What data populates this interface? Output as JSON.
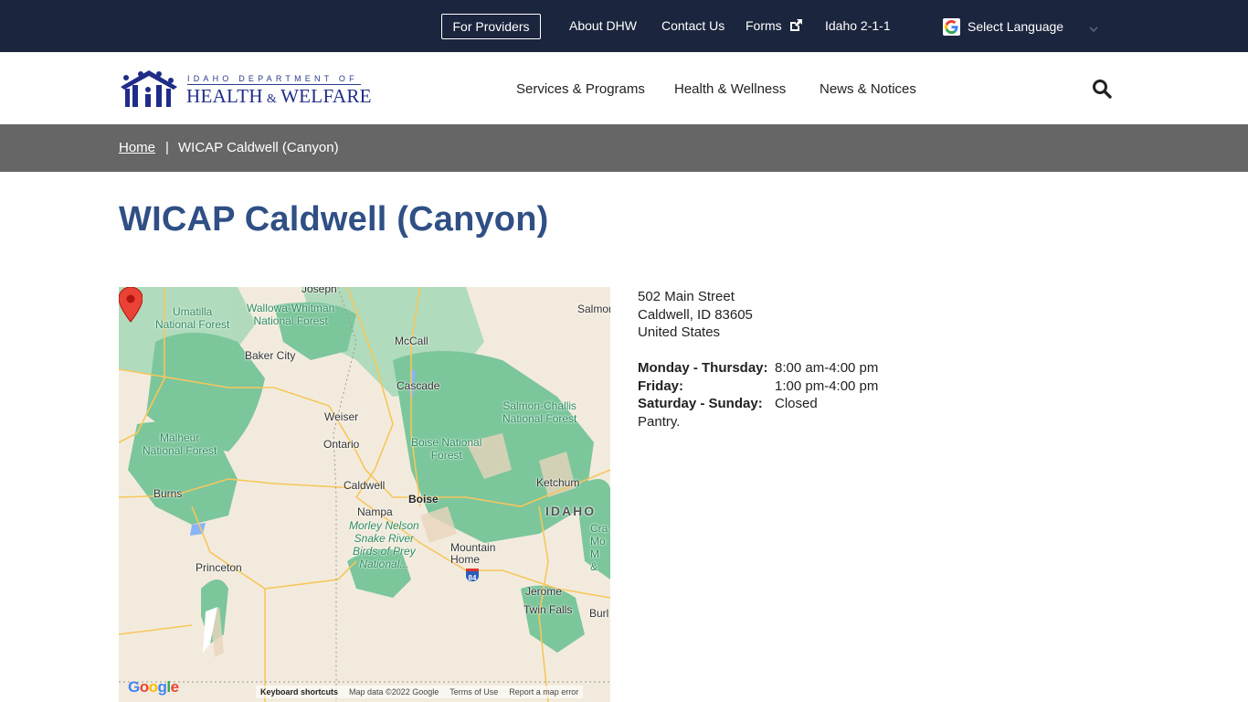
{
  "topbar": {
    "for_providers": "For Providers",
    "links": [
      "About DHW",
      "Contact Us",
      "Forms",
      "Idaho 2-1-1"
    ],
    "forms_icon": "external-link-icon",
    "language": "Select Language"
  },
  "header": {
    "logo_line1": "IDAHO DEPARTMENT OF",
    "logo_line2a": "HEALTH",
    "logo_amp": "&",
    "logo_line2b": "WELFARE",
    "nav": [
      "Services & Programs",
      "Health & Wellness",
      "News & Notices"
    ],
    "search_icon": "search-icon"
  },
  "breadcrumb": {
    "home": "Home",
    "separator": "|",
    "current": "WICAP Caldwell (Canyon)"
  },
  "page": {
    "title": "WICAP Caldwell (Canyon)"
  },
  "location": {
    "address": [
      "502 Main Street",
      "Caldwell, ID 83605",
      "United States"
    ],
    "hours": [
      {
        "day": "Monday - Thursday:",
        "time": "8:00 am-4:00 pm"
      },
      {
        "day": "Friday:",
        "time": "1:00 pm-4:00 pm"
      },
      {
        "day": "Saturday - Sunday:",
        "time": "Closed"
      }
    ],
    "note": "Pantry."
  },
  "map": {
    "labels": {
      "joseph": "Joseph",
      "umatilla": "Umatilla\nNational Forest",
      "wallowa": "Wallowa-Whitman\nNational Forest",
      "salmon": "Salmon",
      "baker": "Baker City",
      "mccall": "McCall",
      "cascade": "Cascade",
      "salmon_challis": "Salmon-Challis\nNational Forest",
      "weiser": "Weiser",
      "malheur": "Malheur\nNational Forest",
      "ontario": "Ontario",
      "boise_nf": "Boise National\nForest",
      "caldwell": "Caldwell",
      "boise": "Boise",
      "ketchum": "Ketchum",
      "burns": "Burns",
      "nampa": "Nampa",
      "idaho": "IDAHO",
      "morley": "Morley Nelson\nSnake River\nBirds of Prey\nNational...",
      "mountain_home": "Mountain\nHome",
      "craters": "Cra\nMo\nM\n&",
      "princeton": "Princeton",
      "jerome": "Jerome",
      "twin_falls": "Twin Falls",
      "burley": "Burl",
      "i84": "84"
    },
    "google": "Google",
    "footer": [
      "Keyboard shortcuts",
      "Map data ©2022 Google",
      "Terms of Use",
      "Report a map error"
    ]
  }
}
